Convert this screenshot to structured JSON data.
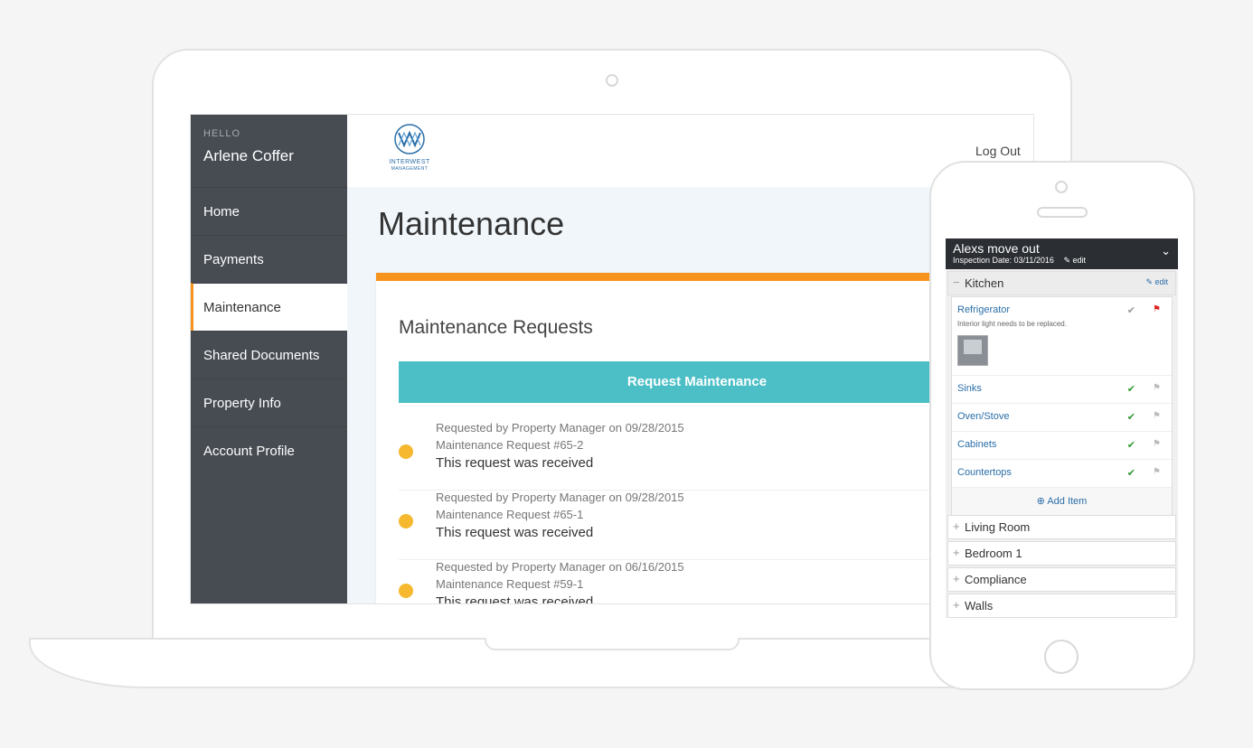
{
  "sidebar": {
    "greeting": "HELLO",
    "user_name": "Arlene Coffer",
    "items": [
      {
        "label": "Home"
      },
      {
        "label": "Payments"
      },
      {
        "label": "Maintenance"
      },
      {
        "label": "Shared Documents"
      },
      {
        "label": "Property Info"
      },
      {
        "label": "Account Profile"
      }
    ]
  },
  "header": {
    "logo_text": "INTERWEST",
    "logo_sub": "MANAGEMENT",
    "logout": "Log Out"
  },
  "main": {
    "title": "Maintenance",
    "card_title": "Maintenance Requests",
    "request_button": "Request Maintenance",
    "requests": [
      {
        "requested_by": "Requested by Property Manager on 09/28/2015",
        "number": "Maintenance Request #65-2",
        "status": "This request was received"
      },
      {
        "requested_by": "Requested by Property Manager on 09/28/2015",
        "number": "Maintenance Request #65-1",
        "status": "This request was received"
      },
      {
        "requested_by": "Requested by Property Manager on 06/16/2015",
        "number": "Maintenance Request #59-1",
        "status": "This request was received"
      }
    ]
  },
  "phone": {
    "title": "Alexs move out",
    "inspection_date": "Inspection Date: 03/11/2016",
    "edit": "edit",
    "kitchen": {
      "label": "Kitchen",
      "edit": "edit",
      "items": [
        {
          "label": "Sinks",
          "status": "ok"
        },
        {
          "label": "Oven/Stove",
          "status": "ok"
        },
        {
          "label": "Cabinets",
          "status": "ok"
        },
        {
          "label": "Countertops",
          "status": "ok"
        }
      ],
      "refrigerator": {
        "label": "Refrigerator",
        "note": "Interior light needs to be replaced."
      },
      "add_item": "Add Item"
    },
    "sections": [
      "Living Room",
      "Bedroom 1",
      "Compliance",
      "Walls"
    ]
  },
  "colors": {
    "accent": "#f7941d",
    "button": "#4cbfc6",
    "sidebar": "#474c53",
    "dot": "#f5b82e"
  }
}
